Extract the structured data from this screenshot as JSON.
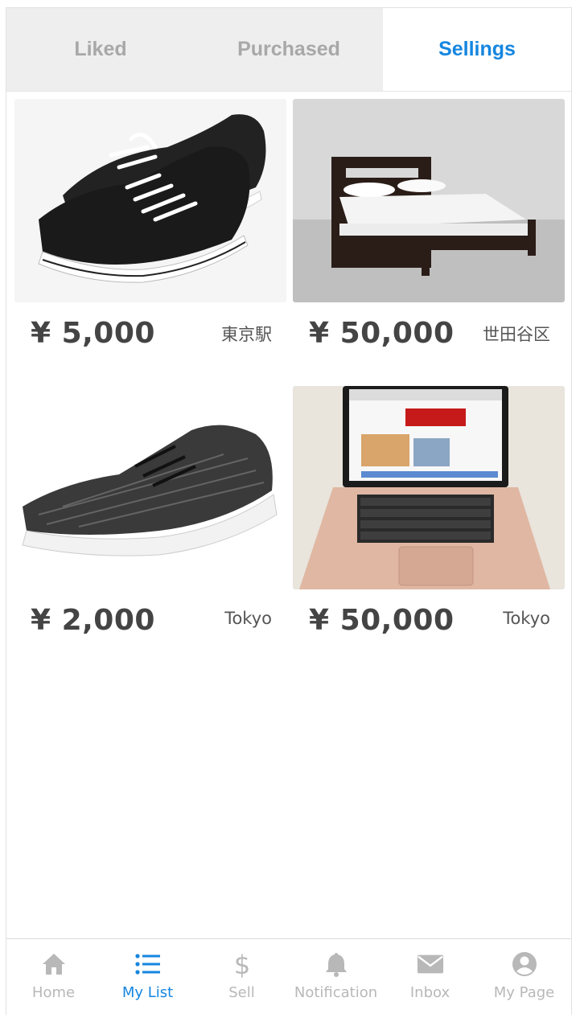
{
  "colors": {
    "accent": "#1586e0",
    "inactive": "#b8b8b8",
    "tab_bg": "#eeeeee"
  },
  "tabs": [
    {
      "label": "Liked",
      "active": false
    },
    {
      "label": "Purchased",
      "active": false
    },
    {
      "label": "Sellings",
      "active": true
    }
  ],
  "items": [
    {
      "image": "black-canvas-sneakers",
      "price": "¥ 5,000",
      "location": "東京駅"
    },
    {
      "image": "bed",
      "price": "¥ 50,000",
      "location": "世田谷区"
    },
    {
      "image": "knit-running-shoe",
      "price": "¥ 2,000",
      "location": "Tokyo"
    },
    {
      "image": "laptop",
      "price": "¥ 50,000",
      "location": "Tokyo"
    }
  ],
  "bottom_nav": [
    {
      "label": "Home",
      "icon": "home-icon",
      "active": false
    },
    {
      "label": "My List",
      "icon": "list-icon",
      "active": true
    },
    {
      "label": "Sell",
      "icon": "dollar-icon",
      "active": false
    },
    {
      "label": "Notification",
      "icon": "bell-icon",
      "active": false
    },
    {
      "label": "Inbox",
      "icon": "mail-icon",
      "active": false
    },
    {
      "label": "My Page",
      "icon": "user-circle-icon",
      "active": false
    }
  ]
}
